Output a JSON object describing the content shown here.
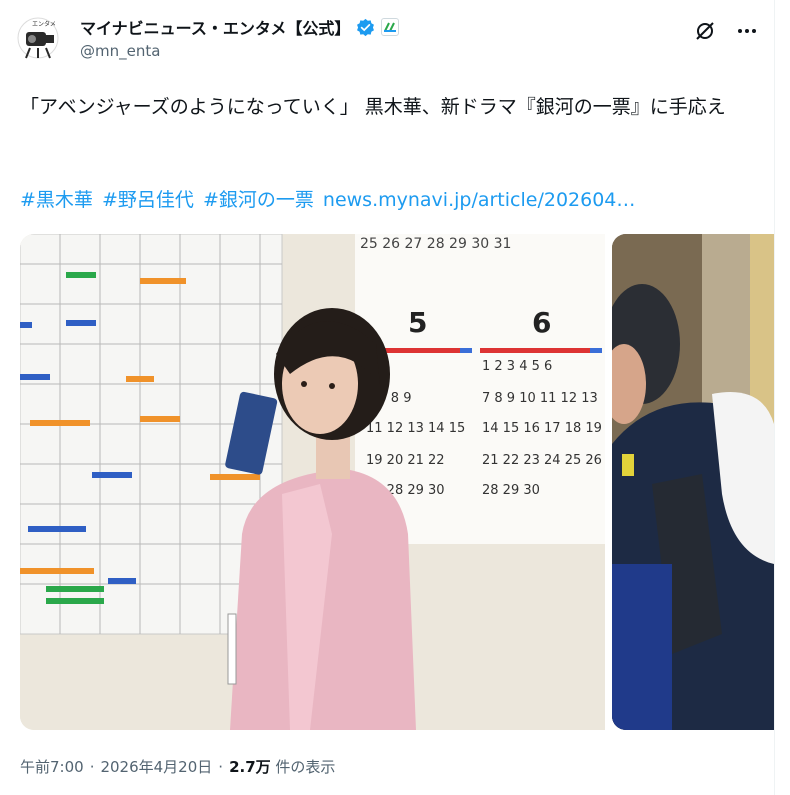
{
  "account": {
    "display_name": "マイナビニュース・エンタメ【公式】",
    "handle": "@mn_enta",
    "verified_icon": "verified-badge-icon",
    "accent": "#1d9bf0"
  },
  "actions": {
    "grok_icon": "grok-slash-icon",
    "more_icon": "more-dots-icon"
  },
  "post": {
    "text": "「アベンジャーズのようになっていく」 黒木華、新ドラマ『銀河の一票』に手応え",
    "hashtags": [
      "#黒木華",
      "#野呂佳代",
      "#銀河の一票"
    ],
    "link": "news.mynavi.jp/article/202604…"
  },
  "media": {
    "photo1_alt": "photo of a woman in pink jacket in front of whiteboard",
    "photo2_alt": "photo of a person with backpack",
    "calendar_months": [
      "5",
      "6"
    ]
  },
  "meta": {
    "time": "午前7:00",
    "sep": "·",
    "date": "2026年4月20日",
    "sep2": "·",
    "views": "2.7万",
    "views_label": "件の表示"
  }
}
